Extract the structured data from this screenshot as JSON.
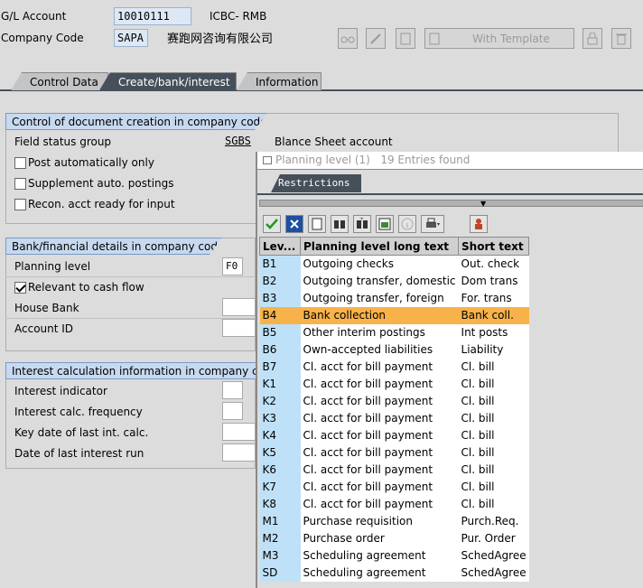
{
  "header": {
    "gl_account_label": "G/L Account",
    "gl_account_value": "10010111",
    "gl_account_desc": "ICBC- RMB",
    "company_code_label": "Company Code",
    "company_code_value": "SAPA",
    "company_name": "赛跑网咨询有限公司"
  },
  "toolbar": {
    "with_template_label": "With Template"
  },
  "tabs": [
    {
      "label": "Control Data"
    },
    {
      "label": "Create/bank/interest"
    },
    {
      "label": "Information"
    }
  ],
  "section1": {
    "title": "Control of document creation in company code",
    "field_status_group_label": "Field status group",
    "field_status_group_value": "SGBS",
    "field_status_group_desc": "Blance Sheet account",
    "post_auto_label": "Post automatically only",
    "supplement_label": "Supplement auto. postings",
    "recon_label": "Recon. acct ready for input"
  },
  "section2": {
    "title": "Bank/financial details in company code",
    "planning_level_label": "Planning level",
    "planning_level_value": "F0",
    "relevant_cash_flow_label": "Relevant to cash flow",
    "house_bank_label": "House Bank",
    "account_id_label": "Account ID"
  },
  "section3": {
    "title": "Interest calculation information in company code",
    "interest_indicator_label": "Interest indicator",
    "interest_freq_label": "Interest calc. frequency",
    "key_date_label": "Key date of last int. calc.",
    "date_last_run_label": "Date of last interest run"
  },
  "popup": {
    "title": "Planning level (1)",
    "entries": "19 Entries found",
    "restrictions_tab": "Restrictions",
    "columns": [
      "Lev...",
      "Planning level long text",
      "Short text"
    ],
    "rows": [
      [
        "B1",
        "Outgoing checks",
        "Out. check"
      ],
      [
        "B2",
        "Outgoing transfer, domestic",
        "Dom trans"
      ],
      [
        "B3",
        "Outgoing transfer, foreign",
        "For. trans"
      ],
      [
        "B4",
        "Bank collection",
        "Bank coll."
      ],
      [
        "B5",
        "Other interim postings",
        "Int posts"
      ],
      [
        "B6",
        "Own-accepted liabilities",
        "Liability"
      ],
      [
        "B7",
        "Cl. acct for bill payment",
        "Cl. bill"
      ],
      [
        "K1",
        "Cl. acct for bill payment",
        "Cl. bill"
      ],
      [
        "K2",
        "Cl. acct for bill payment",
        "Cl. bill"
      ],
      [
        "K3",
        "Cl. acct for bill payment",
        "Cl. bill"
      ],
      [
        "K4",
        "Cl. acct for bill payment",
        "Cl. bill"
      ],
      [
        "K5",
        "Cl. acct for bill payment",
        "Cl. bill"
      ],
      [
        "K6",
        "Cl. acct for bill payment",
        "Cl. bill"
      ],
      [
        "K7",
        "Cl. acct for bill payment",
        "Cl. bill"
      ],
      [
        "K8",
        "Cl. acct for bill payment",
        "Cl. bill"
      ],
      [
        "M1",
        "Purchase requisition",
        "Purch.Req."
      ],
      [
        "M2",
        "Purchase order",
        "Pur. Order"
      ],
      [
        "M3",
        "Scheduling agreement",
        "SchedAgree"
      ],
      [
        "SD",
        "Scheduling agreement",
        "SchedAgree"
      ]
    ],
    "selected_row": 3
  },
  "colors": {
    "selected": "#f7b24a",
    "key_column": "#bfe1f7",
    "active_tab": "#46505a",
    "section_header": "#c7d9ef"
  }
}
